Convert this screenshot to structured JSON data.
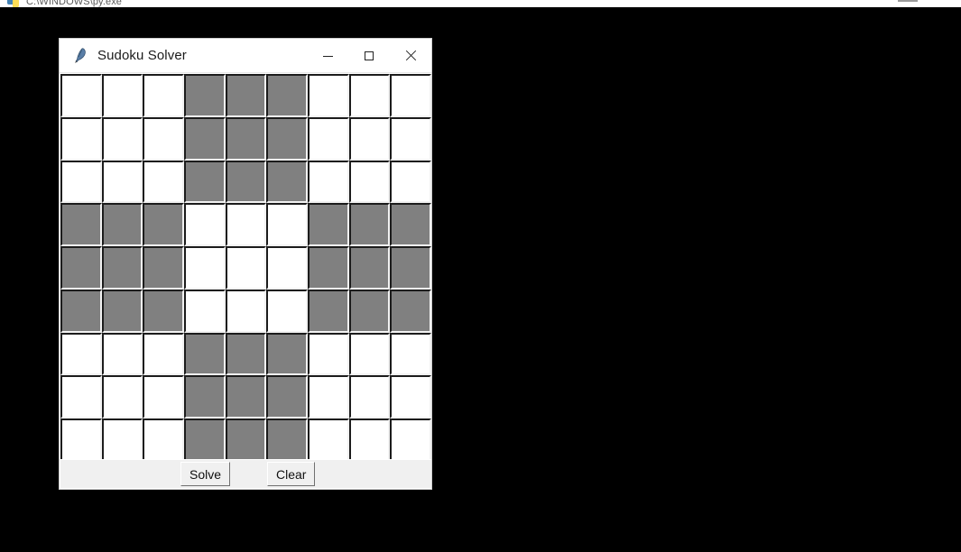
{
  "desktop": {
    "background_color": "#000000"
  },
  "background_window": {
    "title": "C:\\WINDOWS\\py.exe",
    "icon": "python-icon",
    "minimize_label": "Minimize"
  },
  "app_window": {
    "title": "Sudoku Solver",
    "icon": "tkinter-feather-icon",
    "controls": {
      "minimize": "Minimize",
      "maximize": "Maximize",
      "close": "Close"
    },
    "colors": {
      "title_bar": "#ffffff",
      "shaded_cell": "#808080",
      "empty_cell": "#ffffff",
      "panel": "#f0f0f0",
      "cell_border_dark": "#1c1c1c"
    }
  },
  "grid": {
    "rows": 9,
    "columns": 9,
    "box_size": 3,
    "cell_placeholder": "",
    "values": [
      [
        "",
        "",
        "",
        "",
        "",
        "",
        "",
        "",
        ""
      ],
      [
        "",
        "",
        "",
        "",
        "",
        "",
        "",
        "",
        ""
      ],
      [
        "",
        "",
        "",
        "",
        "",
        "",
        "",
        "",
        ""
      ],
      [
        "",
        "",
        "",
        "",
        "",
        "",
        "",
        "",
        ""
      ],
      [
        "",
        "",
        "",
        "",
        "",
        "",
        "",
        "",
        ""
      ],
      [
        "",
        "",
        "",
        "",
        "",
        "",
        "",
        "",
        ""
      ],
      [
        "",
        "",
        "",
        "",
        "",
        "",
        "",
        "",
        ""
      ],
      [
        "",
        "",
        "",
        "",
        "",
        "",
        "",
        "",
        ""
      ],
      [
        "",
        "",
        "",
        "",
        "",
        "",
        "",
        "",
        ""
      ]
    ],
    "shading": [
      [
        0,
        0,
        0,
        1,
        1,
        1,
        0,
        0,
        0
      ],
      [
        0,
        0,
        0,
        1,
        1,
        1,
        0,
        0,
        0
      ],
      [
        0,
        0,
        0,
        1,
        1,
        1,
        0,
        0,
        0
      ],
      [
        1,
        1,
        1,
        0,
        0,
        0,
        1,
        1,
        1
      ],
      [
        1,
        1,
        1,
        0,
        0,
        0,
        1,
        1,
        1
      ],
      [
        1,
        1,
        1,
        0,
        0,
        0,
        1,
        1,
        1
      ],
      [
        0,
        0,
        0,
        1,
        1,
        1,
        0,
        0,
        0
      ],
      [
        0,
        0,
        0,
        1,
        1,
        1,
        0,
        0,
        0
      ],
      [
        0,
        0,
        0,
        1,
        1,
        1,
        0,
        0,
        0
      ]
    ]
  },
  "controls": {
    "solve_label": "Solve",
    "clear_label": "Clear"
  }
}
